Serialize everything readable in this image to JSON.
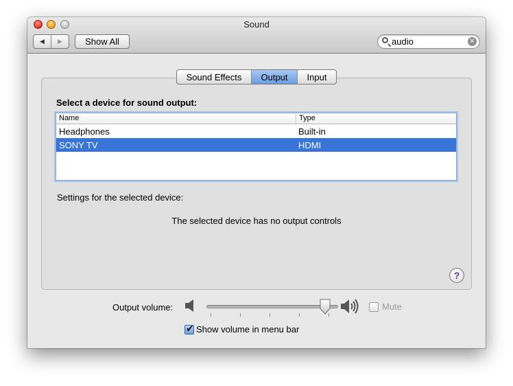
{
  "window": {
    "title": "Sound"
  },
  "toolbar": {
    "back": "◀",
    "forward": "▶",
    "show_all": "Show All",
    "search_value": "audio"
  },
  "tabs": [
    {
      "label": "Sound Effects",
      "selected": false
    },
    {
      "label": "Output",
      "selected": true
    },
    {
      "label": "Input",
      "selected": false
    }
  ],
  "output": {
    "heading": "Select a device for sound output:",
    "columns": [
      "Name",
      "Type"
    ],
    "devices": [
      {
        "name": "Headphones",
        "type": "Built-in",
        "selected": false
      },
      {
        "name": "SONY TV",
        "type": "HDMI",
        "selected": true
      }
    ],
    "settings_label": "Settings for the selected device:",
    "no_controls": "The selected device has no output controls"
  },
  "help": "?",
  "volume": {
    "label": "Output volume:",
    "level": 0.9,
    "mute_label": "Mute",
    "mute_checked": false,
    "menu_bar_label": "Show volume in menu bar",
    "menu_bar_checked": true
  },
  "colors": {
    "selection": "#3875d7",
    "tab_selected": "#6b9ee0"
  }
}
